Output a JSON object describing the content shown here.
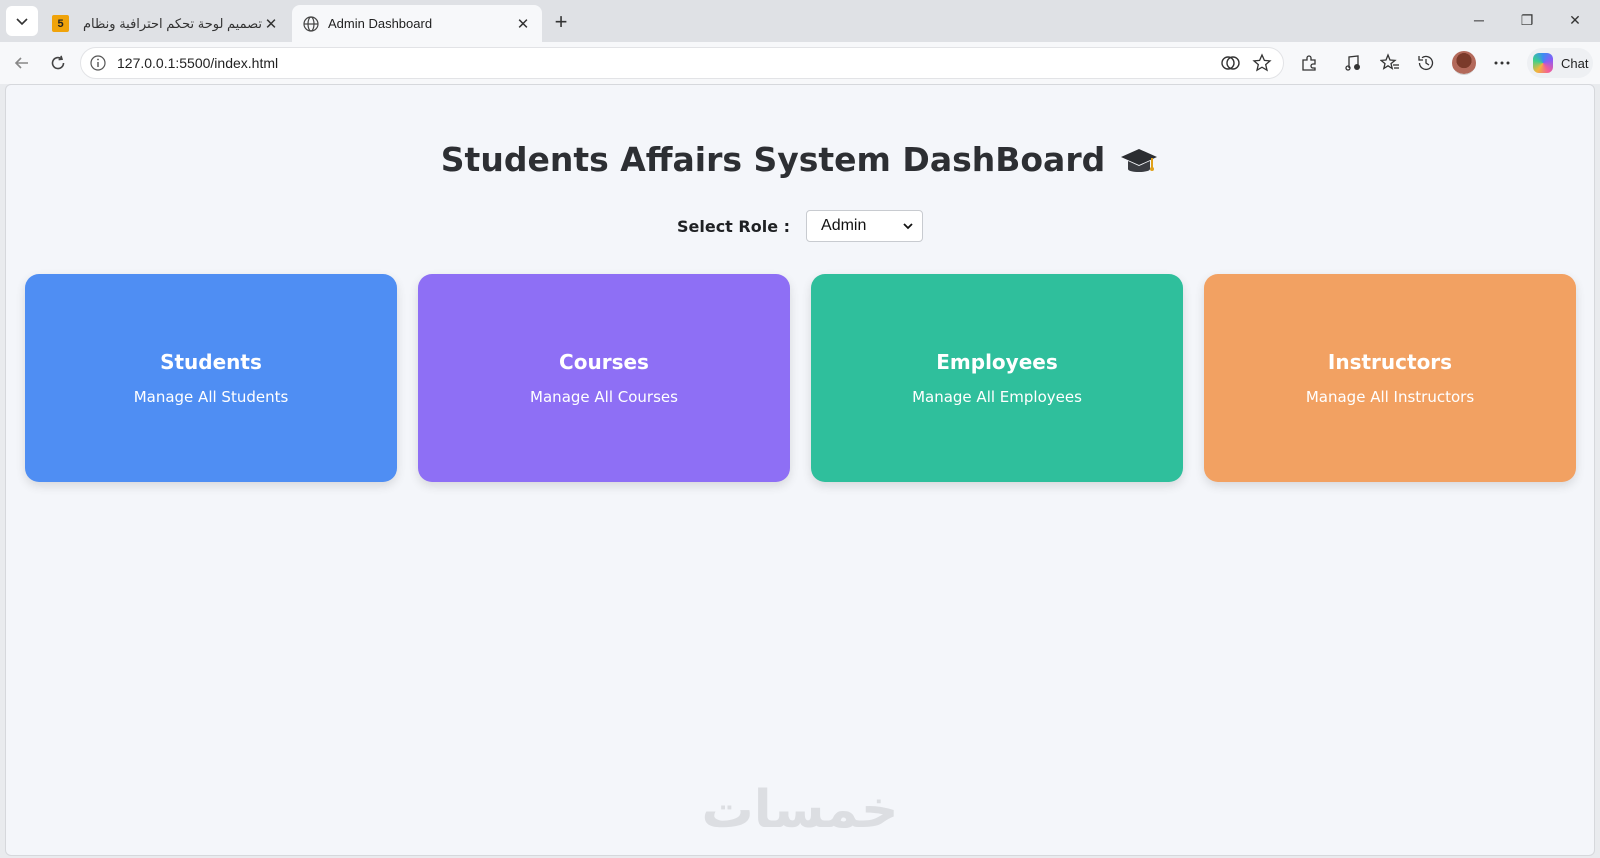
{
  "browser": {
    "tabs": [
      {
        "favicon_text": "5",
        "title": "تصميم لوحة تحكم احترافية ونظام إدار",
        "active": false
      },
      {
        "title": "Admin Dashboard",
        "active": true
      }
    ],
    "url": "127.0.0.1:5500/index.html",
    "chat_label": "Chat"
  },
  "page": {
    "title": "Students Affairs System DashBoard",
    "role_label": "Select Role :",
    "role_value": "Admin",
    "cards": [
      {
        "title": "Students",
        "subtitle": "Manage All Students",
        "color": "#4f8ef3"
      },
      {
        "title": "Courses",
        "subtitle": "Manage All Courses",
        "color": "#8e6ff5"
      },
      {
        "title": "Employees",
        "subtitle": "Manage All Employees",
        "color": "#2fbf9c"
      },
      {
        "title": "Instructors",
        "subtitle": "Manage All Instructors",
        "color": "#f2a162"
      }
    ],
    "watermark": "خمسات"
  }
}
